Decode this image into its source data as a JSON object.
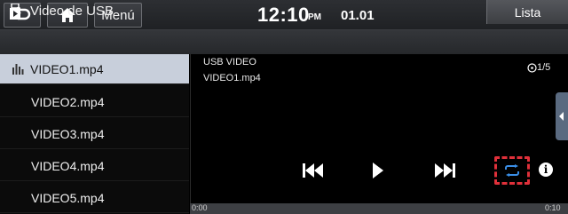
{
  "header": {
    "menu_label": "Menú",
    "clock": "12:10",
    "clock_ampm": "PM",
    "date": "01.01"
  },
  "titlebar": {
    "title": "Video de USB",
    "list_button": "Lista"
  },
  "files": [
    {
      "name": "VIDEO1.mp4",
      "selected": true
    },
    {
      "name": "VIDEO2.mp4",
      "selected": false
    },
    {
      "name": "VIDEO3.mp4",
      "selected": false
    },
    {
      "name": "VIDEO4.mp4",
      "selected": false
    },
    {
      "name": "VIDEO5.mp4",
      "selected": false
    }
  ],
  "player": {
    "source": "USB VIDEO",
    "current_file": "VIDEO1.mp4",
    "count": "1/5",
    "time_start": "0:00",
    "time_end": "0:10",
    "progress": 0
  },
  "icons": {
    "back": "back-arrow-icon",
    "home": "home-icon",
    "usb": "usb-icon",
    "prev": "previous-track-icon",
    "play": "play-icon",
    "next": "next-track-icon",
    "repeat": "repeat-icon",
    "info": "info-icon"
  },
  "colors": {
    "selected_row": "#c8cfdb",
    "repeat_icon": "#3a8ee6",
    "highlight_frame": "#e0303a"
  }
}
